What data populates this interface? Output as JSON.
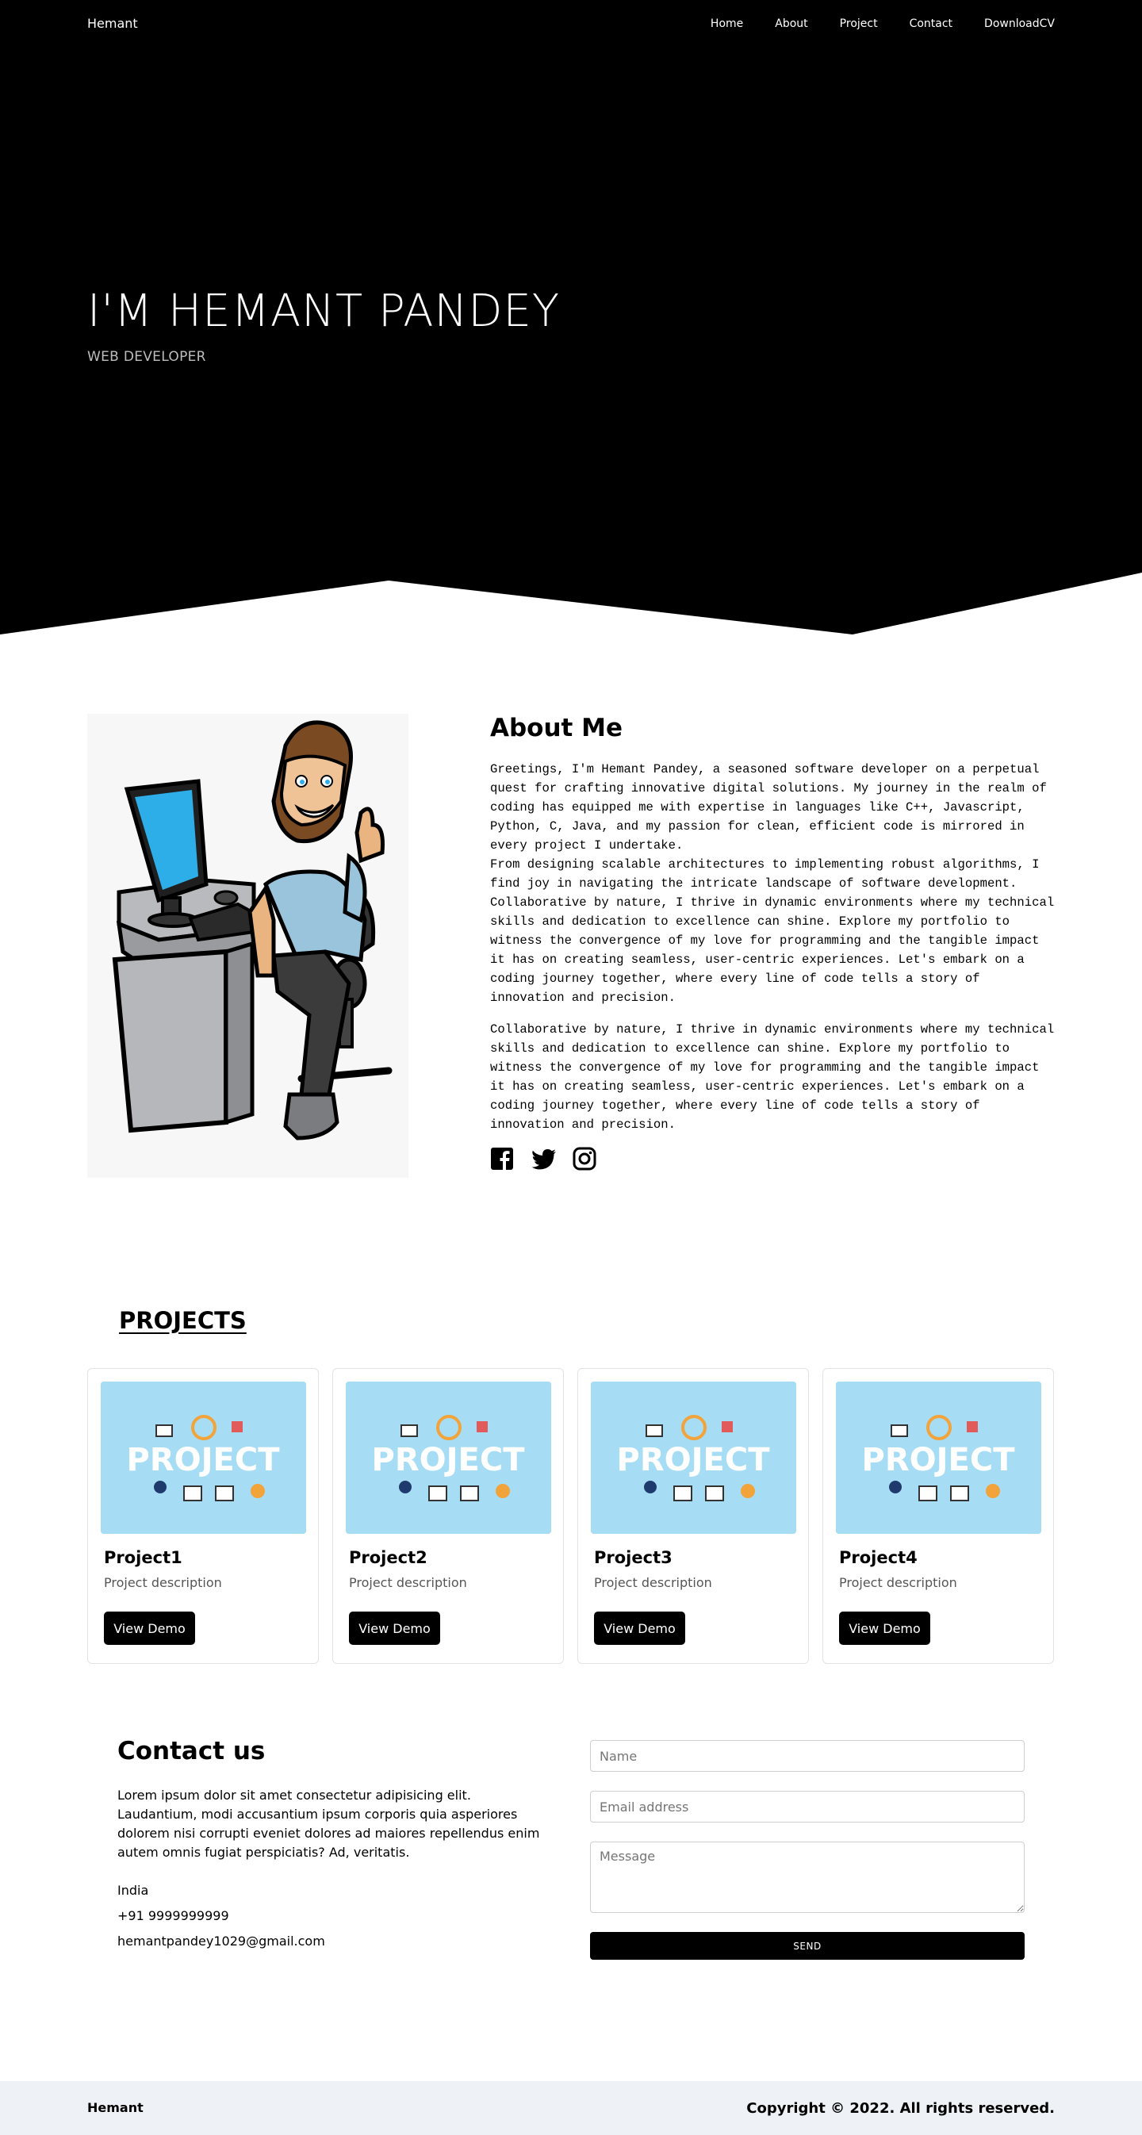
{
  "nav": {
    "brand": "Hemant",
    "links": [
      "Home",
      "About",
      "Project",
      "Contact",
      "DownloadCV"
    ]
  },
  "hero": {
    "title": "I'M HEMANT PANDEY",
    "subtitle": "WEB DEVELOPER",
    "bg_color": "#000000"
  },
  "about": {
    "title": "About Me",
    "paragraph1": "Greetings, I'm Hemant Pandey, a seasoned software developer on a perpetual quest for crafting innovative digital solutions. My journey in the realm of coding has equipped me with expertise in languages like C++, Javascript, Python, C, Java, and my passion for clean, efficient code is mirrored in every project I undertake.\nFrom designing scalable architectures to implementing robust algorithms, I find joy in navigating the intricate landscape of software development. Collaborative by nature, I thrive in dynamic environments where my technical skills and dedication to excellence can shine. Explore my portfolio to witness the convergence of my love for programming and the tangible impact it has on creating seamless, user-centric experiences. Let's embark on a coding journey together, where every line of code tells a story of innovation and precision.",
    "paragraph2": "Collaborative by nature, I thrive in dynamic environments where my technical skills and dedication to excellence can shine. Explore my portfolio to witness the convergence of my love for programming and the tangible impact it has on creating seamless, user-centric experiences. Let's embark on a coding journey together, where every line of code tells a story of innovation and precision.",
    "socials": [
      "facebook-icon",
      "twitter-icon",
      "instagram-icon"
    ]
  },
  "projects": {
    "title": "PROJECTS",
    "image_word": "PROJECT",
    "items": [
      {
        "title": "Project1",
        "description": "Project description",
        "button": "View Demo"
      },
      {
        "title": "Project2",
        "description": "Project description",
        "button": "View Demo"
      },
      {
        "title": "Project3",
        "description": "Project description",
        "button": "View Demo"
      },
      {
        "title": "Project4",
        "description": "Project description",
        "button": "View Demo"
      }
    ]
  },
  "contact": {
    "title": "Contact us",
    "text": "Lorem ipsum dolor sit amet consectetur adipisicing elit. Laudantium, modi accusantium ipsum corporis quia asperiores dolorem nisi corrupti eveniet dolores ad maiores repellendus enim autem omnis fugiat perspiciatis? Ad, veritatis.",
    "country": "India",
    "phone": "+91 9999999999",
    "email": "hemantpandey1029@gmail.com",
    "form": {
      "name_placeholder": "Name",
      "email_placeholder": "Email address",
      "message_placeholder": "Message",
      "send_label": "SEND"
    }
  },
  "footer": {
    "brand": "Hemant",
    "copyright": "Copyright © 2022. All rights reserved.",
    "bg_color": "#eef1f5"
  }
}
